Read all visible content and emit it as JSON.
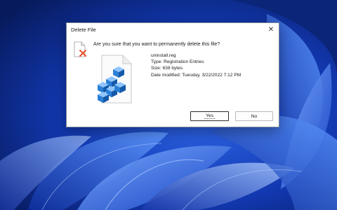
{
  "window": {
    "title": "Delete File",
    "close_glyph": "✕"
  },
  "dialog": {
    "question": "Are you sure that you want to permanently delete this file?",
    "warning_icon": "file-delete-warning-icon",
    "file_icon": "registry-file-icon",
    "file": {
      "name": "uninstall.reg",
      "type": "Type: Registration Entries",
      "size": "Size: 638 bytes",
      "modified": "Date modified: Tuesday, 3/22/2022 7:12 PM"
    }
  },
  "buttons": {
    "yes_label": "Yes",
    "no_label": "No"
  },
  "colors": {
    "wallpaper_dark": "#0a2a8a",
    "wallpaper_light": "#4f8dff",
    "dialog_bg": "#f3f3f3",
    "registry_blue": "#2a7fd6"
  }
}
